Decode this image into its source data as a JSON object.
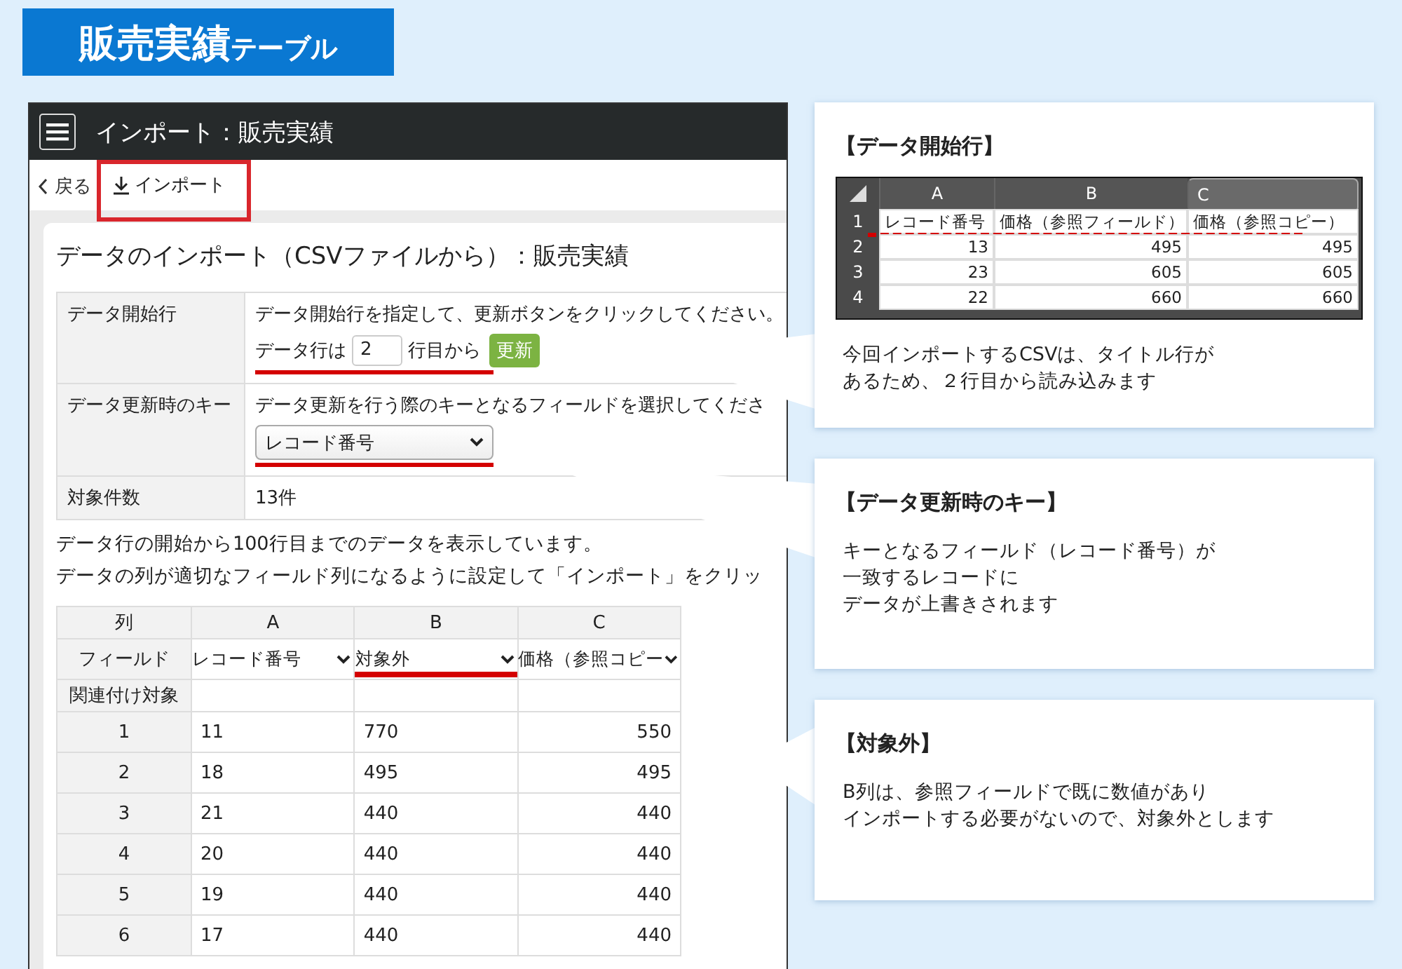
{
  "banner": {
    "title": "販売実績",
    "subtitle": "テーブル"
  },
  "window": {
    "title": "インポート：販売実績",
    "back": "戻る",
    "import_button": "インポート",
    "import_highlighted": true
  },
  "heading": "データのインポート（CSVファイルから）：販売実績",
  "settings": [
    {
      "kind": "start_row",
      "label": "データ開始行",
      "description": "データ開始行を指定して、更新ボタンをクリックしてください。",
      "prefix": "データ行は",
      "value": "2",
      "suffix": "行目から",
      "button": "更新",
      "underlined": true
    },
    {
      "kind": "select",
      "label": "データ更新時のキー",
      "description": "データ更新を行う際のキーとなるフィールドを選択してくださ",
      "value": "レコード番号",
      "underlined": true
    },
    {
      "kind": "text",
      "label": "対象件数",
      "value": "13件",
      "underlined": false
    }
  ],
  "notes": [
    "データ行の開始から100行目までのデータを表示しています。",
    "データの列が適切なフィールド列になるように設定して「インポート」をクリッ"
  ],
  "mapping_table": {
    "column_label": "列",
    "columns": [
      "A",
      "B",
      "C"
    ],
    "field_label": "フィールド",
    "fields": [
      {
        "label": "レコード番号",
        "underlined": false
      },
      {
        "label": "対象外",
        "underlined": true
      },
      {
        "label": "価格（参照コピー",
        "underlined": false
      }
    ],
    "related_label": "関連付け対象",
    "rows": [
      {
        "index": "1",
        "cells": [
          "11",
          "770",
          "550"
        ]
      },
      {
        "index": "2",
        "cells": [
          "18",
          "495",
          "495"
        ]
      },
      {
        "index": "3",
        "cells": [
          "21",
          "440",
          "440"
        ]
      },
      {
        "index": "4",
        "cells": [
          "20",
          "440",
          "440"
        ]
      },
      {
        "index": "5",
        "cells": [
          "19",
          "440",
          "440"
        ]
      },
      {
        "index": "6",
        "cells": [
          "17",
          "440",
          "440"
        ]
      }
    ]
  },
  "callouts": [
    {
      "kind": "sheet",
      "title": "【データ開始行】",
      "sheet": {
        "columns": [
          {
            "label": "A",
            "selected": false
          },
          {
            "label": "B",
            "selected": false
          },
          {
            "label": "C",
            "selected": true
          }
        ],
        "rows": [
          {
            "index": "1",
            "cells": [
              "レコード番号",
              "価格（参照フィールド）",
              "価格（参照コピー）"
            ],
            "underlined": true,
            "kind": "header"
          },
          {
            "index": "2",
            "cells": [
              "13",
              "495",
              "495"
            ],
            "underlined": false,
            "kind": "data"
          },
          {
            "index": "3",
            "cells": [
              "23",
              "605",
              "605"
            ],
            "underlined": false,
            "kind": "data"
          },
          {
            "index": "4",
            "cells": [
              "22",
              "660",
              "660"
            ],
            "underlined": false,
            "kind": "data"
          }
        ]
      },
      "lines": [
        "今回インポートするCSVは、タイトル行が",
        "あるため、２行目から読み込みます"
      ]
    },
    {
      "kind": "text",
      "title": "【データ更新時のキー】",
      "lines": [
        "キーとなるフィールド（レコード番号）が",
        "一致するレコードに",
        "データが上書きされます"
      ]
    },
    {
      "kind": "text",
      "title": "【対象外】",
      "lines": [
        "B列は、参照フィールドで既に数値があり",
        "インポートする必要がないので、対象外とします"
      ]
    }
  ]
}
